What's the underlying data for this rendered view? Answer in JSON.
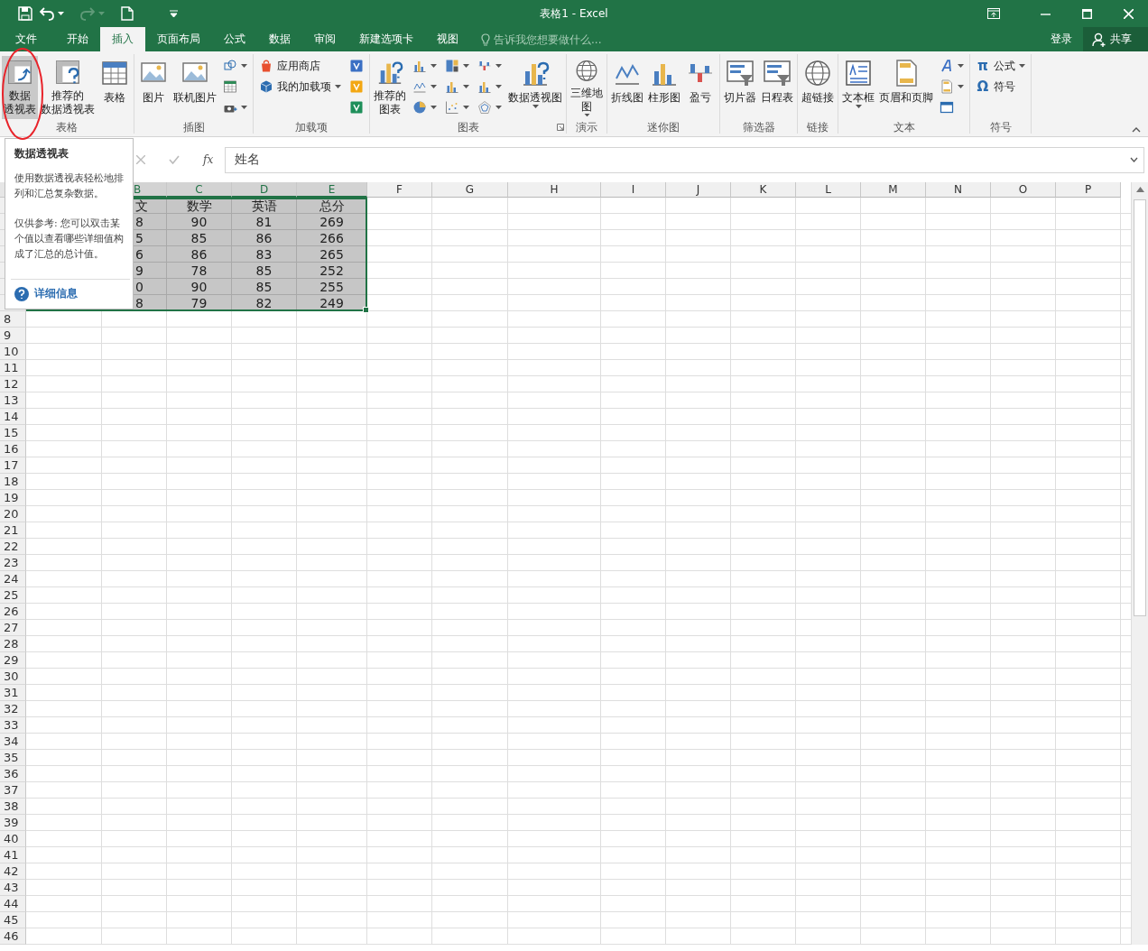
{
  "window": {
    "title": "表格1 - Excel"
  },
  "tabs": [
    {
      "label": "文件",
      "selected": false
    },
    {
      "label": "开始",
      "selected": false
    },
    {
      "label": "插入",
      "selected": true
    },
    {
      "label": "页面布局",
      "selected": false
    },
    {
      "label": "公式",
      "selected": false
    },
    {
      "label": "数据",
      "selected": false
    },
    {
      "label": "审阅",
      "selected": false
    },
    {
      "label": "新建选项卡",
      "selected": false
    },
    {
      "label": "视图",
      "selected": false
    }
  ],
  "tell_me": {
    "placeholder": "告诉我您想要做什么..."
  },
  "account": {
    "sign_in": "登录",
    "share": "共享"
  },
  "ribbon": {
    "groups": [
      {
        "label": "表格",
        "launcher": false,
        "items": [
          {
            "kind": "large",
            "label": [
              "数据",
              "透视表"
            ],
            "hovered": true,
            "dropdown": false
          },
          {
            "kind": "large",
            "label": [
              "推荐的",
              "数据透视表"
            ],
            "hovered": false,
            "dropdown": false
          },
          {
            "kind": "large",
            "label": [
              "表格"
            ],
            "hovered": false,
            "dropdown": false
          }
        ]
      },
      {
        "label": "插图",
        "launcher": false,
        "items": [
          {
            "kind": "large",
            "label": [
              "图片"
            ],
            "dropdown": false
          },
          {
            "kind": "large",
            "label": [
              "联机图片"
            ],
            "dropdown": false
          },
          {
            "kind": "stack",
            "items": [
              {
                "kind": "icon",
                "dropdown": true
              },
              {
                "kind": "icon",
                "dropdown": false
              },
              {
                "kind": "icon",
                "dropdown": true
              }
            ]
          }
        ]
      },
      {
        "label": "加载项",
        "launcher": false,
        "items": [
          {
            "kind": "stack",
            "items": [
              {
                "kind": "small",
                "label": "应用商店",
                "dropdown": false
              },
              {
                "kind": "small",
                "label": "我的加载项",
                "dropdown": true
              }
            ]
          },
          {
            "kind": "stack",
            "items": [
              {
                "kind": "icon",
                "dropdown": false
              },
              {
                "kind": "icon",
                "dropdown": false
              },
              {
                "kind": "icon",
                "dropdown": false
              }
            ]
          }
        ]
      },
      {
        "label": "图表",
        "launcher": true,
        "items": [
          {
            "kind": "large",
            "label": [
              "推荐的",
              "图表"
            ],
            "dropdown": false
          },
          {
            "kind": "stack",
            "items": [
              {
                "kind": "icon",
                "dropdown": true
              },
              {
                "kind": "icon",
                "dropdown": true
              },
              {
                "kind": "icon",
                "dropdown": true
              }
            ]
          },
          {
            "kind": "stack",
            "items": [
              {
                "kind": "icon",
                "dropdown": true
              },
              {
                "kind": "icon",
                "dropdown": true
              },
              {
                "kind": "icon",
                "dropdown": true
              }
            ]
          },
          {
            "kind": "stack",
            "items": [
              {
                "kind": "icon",
                "dropdown": true
              },
              {
                "kind": "icon",
                "dropdown": true
              },
              {
                "kind": "icon",
                "dropdown": true
              }
            ]
          },
          {
            "kind": "large",
            "label": [
              "数据透视图"
            ],
            "dropdown": true
          }
        ]
      },
      {
        "label": "演示",
        "launcher": false,
        "items": [
          {
            "kind": "large",
            "label": [
              "三维地",
              "图"
            ],
            "dropdown": true
          }
        ]
      },
      {
        "label": "迷你图",
        "launcher": false,
        "items": [
          {
            "kind": "large",
            "label": [
              "折线图"
            ],
            "dropdown": false
          },
          {
            "kind": "large",
            "label": [
              "柱形图"
            ],
            "dropdown": false
          },
          {
            "kind": "large",
            "label": [
              "盈亏"
            ],
            "dropdown": false
          }
        ]
      },
      {
        "label": "筛选器",
        "launcher": false,
        "items": [
          {
            "kind": "large",
            "label": [
              "切片器"
            ],
            "dropdown": false
          },
          {
            "kind": "large",
            "label": [
              "日程表"
            ],
            "dropdown": false
          }
        ]
      },
      {
        "label": "链接",
        "launcher": false,
        "items": [
          {
            "kind": "large",
            "label": [
              "超链接"
            ],
            "dropdown": false
          }
        ]
      },
      {
        "label": "文本",
        "launcher": false,
        "items": [
          {
            "kind": "large",
            "label": [
              "文本框"
            ],
            "dropdown": true
          },
          {
            "kind": "large",
            "label": [
              "页眉和页脚"
            ],
            "dropdown": false
          },
          {
            "kind": "stack",
            "items": [
              {
                "kind": "icon",
                "dropdown": true
              },
              {
                "kind": "icon",
                "dropdown": true
              },
              {
                "kind": "icon",
                "dropdown": false
              }
            ]
          }
        ]
      },
      {
        "label": "符号",
        "launcher": false,
        "items": [
          {
            "kind": "stack",
            "items": [
              {
                "kind": "small",
                "glyph": "π",
                "label": "公式",
                "dropdown": true
              },
              {
                "kind": "small",
                "glyph": "Ω",
                "label": "符号",
                "dropdown": false
              }
            ]
          }
        ]
      }
    ]
  },
  "formula_bar": {
    "function_label": "fx",
    "value": "姓名"
  },
  "columns": [
    {
      "label": "B",
      "selected": true
    },
    {
      "label": "C",
      "selected": true
    },
    {
      "label": "D",
      "selected": true
    },
    {
      "label": "E",
      "selected": true
    },
    {
      "label": "F",
      "selected": false
    },
    {
      "label": "G",
      "selected": false
    },
    {
      "label": "H",
      "selected": false
    },
    {
      "label": "I",
      "selected": false
    },
    {
      "label": "J",
      "selected": false
    },
    {
      "label": "K",
      "selected": false
    },
    {
      "label": "L",
      "selected": false
    },
    {
      "label": "M",
      "selected": false
    },
    {
      "label": "N",
      "selected": false
    },
    {
      "label": "O",
      "selected": false
    },
    {
      "label": "P",
      "selected": false
    }
  ],
  "data_rows": [
    {
      "selected": true,
      "cells": [
        "文",
        "数学",
        "英语",
        "总分"
      ]
    },
    {
      "selected": true,
      "cells": [
        "8",
        "90",
        "81",
        "269"
      ]
    },
    {
      "selected": true,
      "cells": [
        "5",
        "85",
        "86",
        "266"
      ]
    },
    {
      "selected": true,
      "cells": [
        "6",
        "86",
        "83",
        "265"
      ]
    },
    {
      "selected": true,
      "cells": [
        "9",
        "78",
        "85",
        "252"
      ]
    },
    {
      "selected": true,
      "cells": [
        "0",
        "90",
        "85",
        "255"
      ]
    },
    {
      "selected": true,
      "cells": [
        "8",
        "79",
        "82",
        "249"
      ]
    }
  ],
  "row_headers": [
    "8",
    "9",
    "10",
    "11",
    "12",
    "13",
    "14",
    "15",
    "16",
    "17",
    "18",
    "19",
    "20",
    "21",
    "22",
    "23",
    "24",
    "25",
    "26",
    "27",
    "28",
    "29",
    "30",
    "31",
    "32",
    "33",
    "34",
    "35",
    "36",
    "37",
    "38",
    "39",
    "40",
    "41",
    "42",
    "43",
    "44",
    "45",
    "46"
  ],
  "tooltip": {
    "title": "数据透视表",
    "description": "使用数据透视表轻松地排列和汇总复杂数据。",
    "note": "仅供参考: 您可以双击某个值以查看哪些详细值构成了汇总的总计值。",
    "link": "详细信息"
  }
}
